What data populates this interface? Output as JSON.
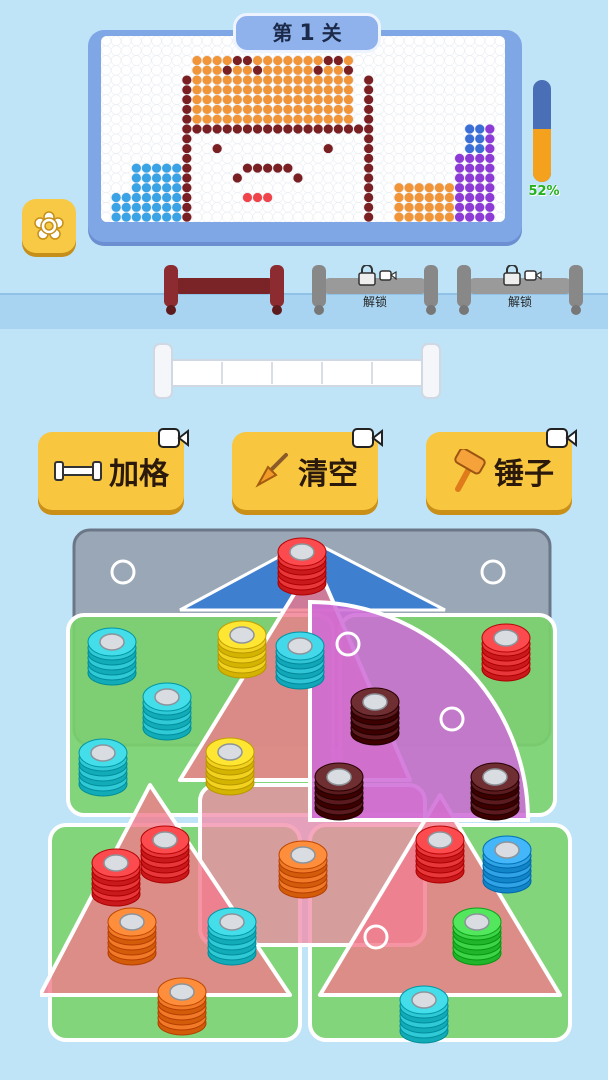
{
  "level": {
    "prefix": "第",
    "number": "1",
    "suffix": "关"
  },
  "progress": {
    "percent_text": "52%",
    "fraction": 0.52
  },
  "locked_slots": [
    {
      "label": "解锁"
    },
    {
      "label": "解锁"
    }
  ],
  "powerups": [
    {
      "label": "加格",
      "icon": "dumbbell-icon"
    },
    {
      "label": "清空",
      "icon": "broom-icon"
    },
    {
      "label": "锤子",
      "icon": "hammer-icon"
    }
  ],
  "colors": {
    "background": "#bfe3f7",
    "board": "#7fa7e6",
    "button": "#f8c63f",
    "progress_fill": "#f4a21d",
    "progress_text": "#24b21c"
  }
}
